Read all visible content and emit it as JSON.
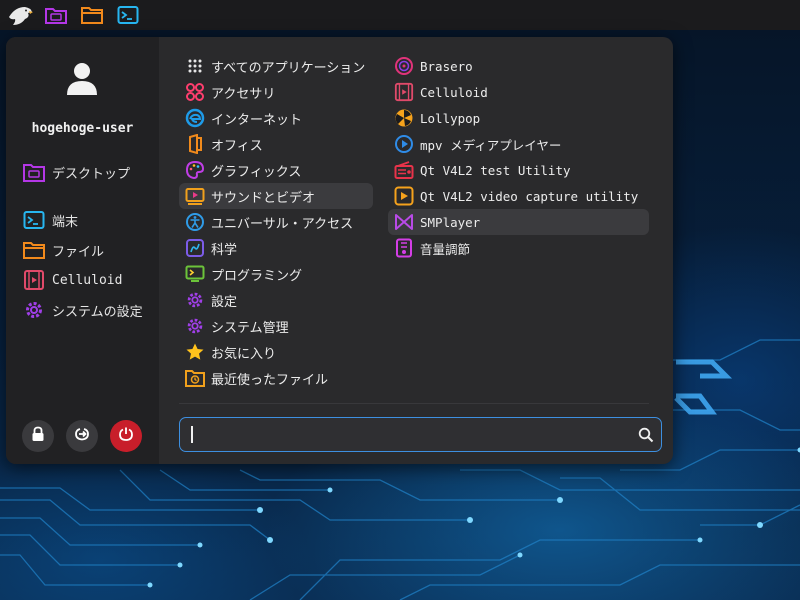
{
  "panel": {
    "items": [
      {
        "name": "app-menu-logo",
        "icon": "eagle-logo"
      },
      {
        "name": "file-manager-desktop",
        "icon": "purple-folder-icon"
      },
      {
        "name": "file-manager",
        "icon": "orange-folder-icon"
      },
      {
        "name": "terminal",
        "icon": "terminal-icon"
      }
    ]
  },
  "user": {
    "name": "hogehoge-user"
  },
  "sidebar": {
    "items": [
      {
        "label": "デスクトップ",
        "icon": "desktop-folder-icon"
      },
      {
        "label": "端末",
        "icon": "terminal-icon"
      },
      {
        "label": "ファイル",
        "icon": "folder-icon"
      },
      {
        "label": "Celluloid",
        "icon": "film-icon"
      },
      {
        "label": "システムの設定",
        "icon": "gear-icon"
      }
    ],
    "actions": [
      "lock",
      "logout",
      "power"
    ]
  },
  "categories": [
    {
      "label": "すべてのアプリケーション",
      "icon": "grid-icon"
    },
    {
      "label": "アクセサリ",
      "icon": "accessories-icon"
    },
    {
      "label": "インターネット",
      "icon": "globe-icon"
    },
    {
      "label": "オフィス",
      "icon": "office-icon"
    },
    {
      "label": "グラフィックス",
      "icon": "palette-icon"
    },
    {
      "label": "サウンドとビデオ",
      "icon": "media-icon",
      "active": true
    },
    {
      "label": "ユニバーサル・アクセス",
      "icon": "accessibility-icon"
    },
    {
      "label": "科学",
      "icon": "science-icon"
    },
    {
      "label": "プログラミング",
      "icon": "programming-icon"
    },
    {
      "label": "設定",
      "icon": "gear-icon"
    },
    {
      "label": "システム管理",
      "icon": "gear-icon"
    },
    {
      "label": "お気に入り",
      "icon": "star-icon"
    },
    {
      "label": "最近使ったファイル",
      "icon": "recent-folder-icon"
    }
  ],
  "apps": [
    {
      "label": "Brasero",
      "icon": "disc-icon"
    },
    {
      "label": "Celluloid",
      "icon": "film-icon"
    },
    {
      "label": "Lollypop",
      "icon": "lollypop-icon"
    },
    {
      "label": "mpv メディアプレイヤー",
      "icon": "play-icon"
    },
    {
      "label": "Qt V4L2 test Utility",
      "icon": "radio-icon"
    },
    {
      "label": "Qt V4L2 video capture utility",
      "icon": "capture-icon"
    },
    {
      "label": "SMPlayer",
      "icon": "smplayer-icon",
      "active": true
    },
    {
      "label": "音量調節",
      "icon": "mixer-icon"
    }
  ],
  "search": {
    "value": "",
    "placeholder": ""
  },
  "colors": {
    "accent": "#3d8fe0",
    "power": "#c81e2a",
    "menu_bg": "#2a2a2c",
    "sidebar_bg": "#212123"
  }
}
